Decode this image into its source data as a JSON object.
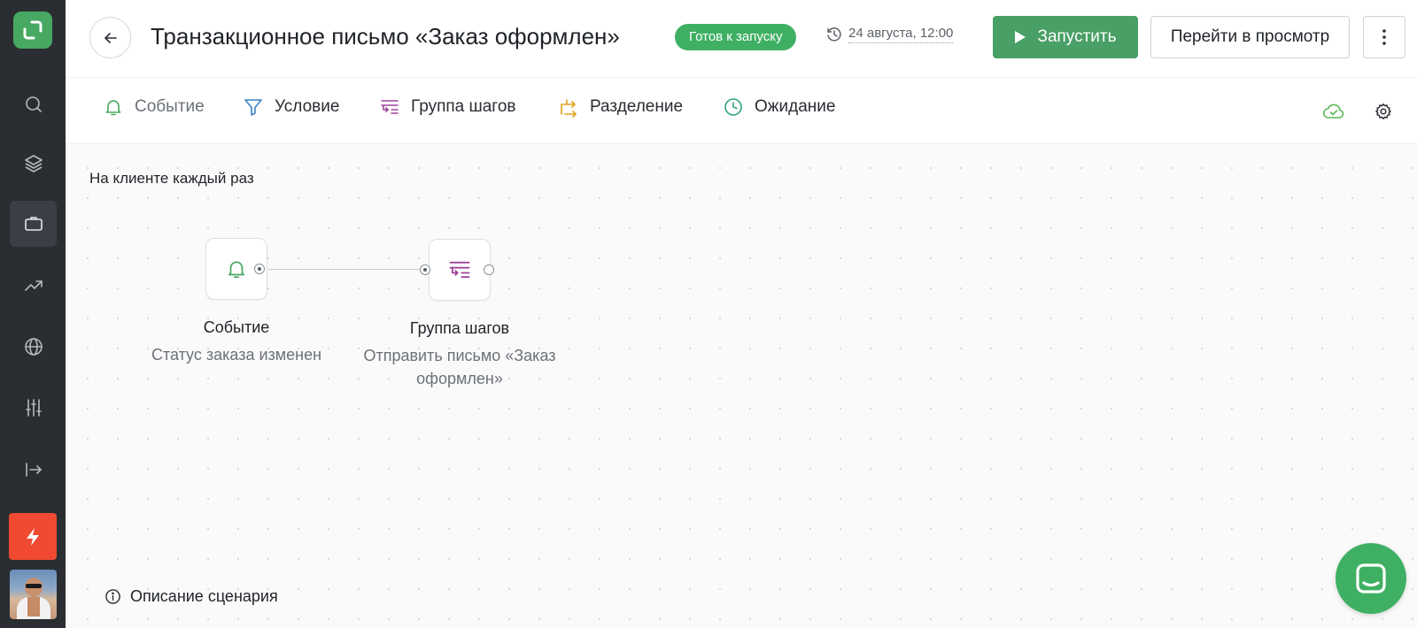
{
  "header": {
    "title": "Транзакционное письмо «Заказ оформлен»",
    "status": "Готов к запуску",
    "schedule": "24 августа, 12:00",
    "run_label": "Запустить",
    "preview_label": "Перейти в просмотр"
  },
  "toolbar": {
    "items": [
      {
        "label": "Событие",
        "icon": "bell-icon",
        "color": "#47a861"
      },
      {
        "label": "Условие",
        "icon": "filter-icon",
        "color": "#3b82c4"
      },
      {
        "label": "Группа шагов",
        "icon": "step-group-icon",
        "color": "#a0449b"
      },
      {
        "label": "Разделение",
        "icon": "split-icon",
        "color": "#e0a21b"
      },
      {
        "label": "Ожидание",
        "icon": "clock-icon",
        "color": "#2fa37a"
      }
    ]
  },
  "canvas": {
    "trigger_label": "На клиенте каждый раз",
    "nodes": [
      {
        "title": "Событие",
        "subtitle": "Статус заказа изменен",
        "icon": "bell-icon"
      },
      {
        "title": "Группа шагов",
        "subtitle": "Отправить письмо «Заказ оформлен»",
        "icon": "step-group-icon"
      }
    ],
    "description_link": "Описание сценария"
  },
  "sidebar": {
    "items": [
      {
        "name": "logo",
        "icon": "logo-icon"
      },
      {
        "name": "search",
        "icon": "search-icon"
      },
      {
        "name": "layers",
        "icon": "layers-icon"
      },
      {
        "name": "campaigns",
        "icon": "briefcase-icon",
        "active": true
      },
      {
        "name": "analytics",
        "icon": "trend-icon"
      },
      {
        "name": "web",
        "icon": "globe-icon"
      },
      {
        "name": "settings",
        "icon": "sliders-icon"
      },
      {
        "name": "exit",
        "icon": "export-icon"
      },
      {
        "name": "activity",
        "icon": "bolt-icon"
      },
      {
        "name": "profile",
        "icon": "avatar"
      }
    ]
  },
  "colors": {
    "accent_green": "#49a066",
    "badge_green": "#3fb063",
    "rail_bg": "#2a2d32",
    "alert_red": "#f04a32"
  }
}
